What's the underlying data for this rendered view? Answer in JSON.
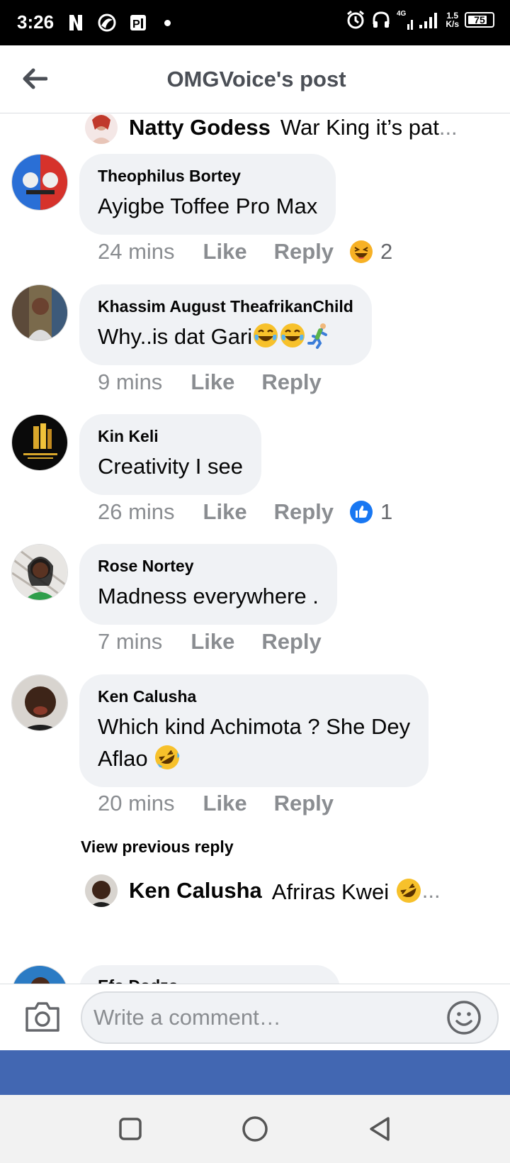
{
  "status_bar": {
    "time": "3:26",
    "network_speed": "1.5",
    "network_unit": "K/s",
    "signal_label": "4G",
    "battery": "75"
  },
  "header": {
    "title": "OMGVoice's post"
  },
  "top_reply": {
    "name": "Natty Godess",
    "text": "War King it’s pat",
    "ellipsis": "..."
  },
  "comments": [
    {
      "name": "Theophilus Bortey",
      "text": "Ayigbe Toffee Pro Max",
      "time": "24 mins",
      "like": "Like",
      "reply": "Reply",
      "reaction": "haha",
      "reaction_count": "2"
    },
    {
      "name": "Khassim August TheafrikanChild",
      "text": "Why..is dat Gari",
      "time": "9 mins",
      "like": "Like",
      "reply": "Reply"
    },
    {
      "name": "Kin Keli",
      "text": "Creativity I see",
      "time": "26 mins",
      "like": "Like",
      "reply": "Reply",
      "reaction": "like",
      "reaction_count": "1"
    },
    {
      "name": "Rose Nortey",
      "text": "Madness everywhere .",
      "time": "7 mins",
      "like": "Like",
      "reply": "Reply"
    },
    {
      "name": "Ken Calusha",
      "text_line1": "Which kind Achimota ? She Dey",
      "text_line2": "Aflao",
      "time": "20 mins",
      "like": "Like",
      "reply": "Reply"
    }
  ],
  "view_previous": "View previous reply",
  "bottom_reply": {
    "name": "Ken Calusha",
    "text": "Afriras Kwei",
    "ellipsis": "..."
  },
  "partial_comment_name": "Efo Dodzo",
  "composer": {
    "placeholder": "Write a comment…"
  },
  "colors": {
    "facebook_blue": "#4267b2",
    "bubble_bg": "#f0f2f5",
    "meta_gray": "#8a8d91",
    "like_blue": "#1877f2"
  }
}
